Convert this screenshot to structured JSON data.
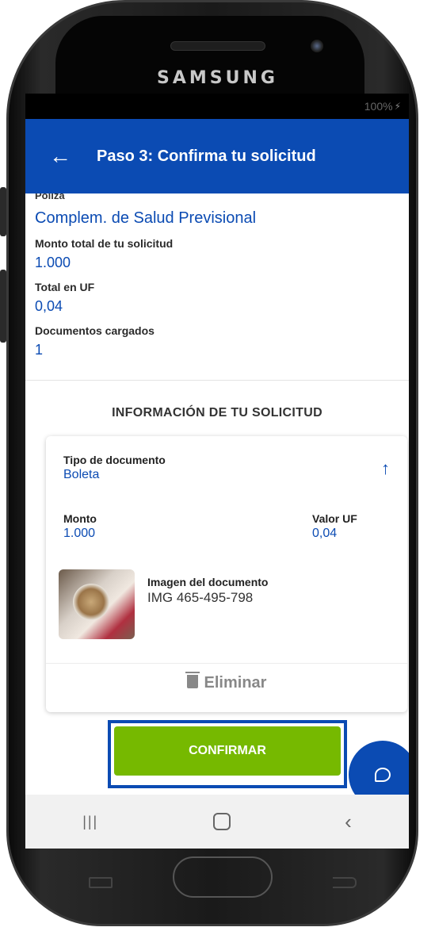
{
  "device": {
    "brand": "SAMSUNG"
  },
  "status_bar": {
    "battery": "100%"
  },
  "app_bar": {
    "title": "Paso 3: Confirma tu solicitud"
  },
  "summary": {
    "poliza_label": "Póliza",
    "poliza_value": "Complem. de Salud Previsional",
    "fields": [
      {
        "label": "Monto total de tu solicitud",
        "value": "1.000"
      },
      {
        "label": "Total en UF",
        "value": "0,04"
      },
      {
        "label": "Documentos cargados",
        "value": "1"
      }
    ]
  },
  "request_info": {
    "title": "INFORMACIÓN DE TU SOLICITUD",
    "tipo_label": "Tipo de documento",
    "tipo_value": "Boleta",
    "monto_label": "Monto",
    "monto_value": "1.000",
    "uf_label": "Valor UF",
    "uf_value": "0,04",
    "imagen_label": "Imagen del documento",
    "imagen_value": "IMG 465-495-798",
    "delete_label": "Eliminar"
  },
  "actions": {
    "confirm_label": "CONFIRMAR"
  },
  "colors": {
    "primary": "#0b4bb3",
    "confirm": "#76b900"
  }
}
